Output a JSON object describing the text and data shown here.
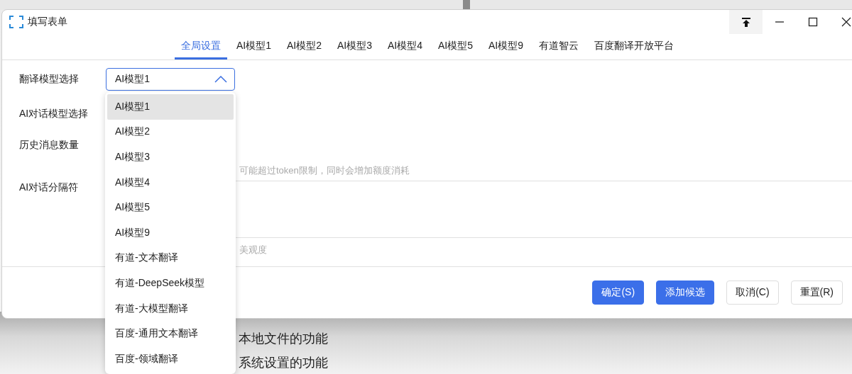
{
  "window": {
    "title": "填写表单"
  },
  "tabs": [
    {
      "label": "全局设置",
      "selected": true
    },
    {
      "label": "AI模型1",
      "selected": false
    },
    {
      "label": "AI模型2",
      "selected": false
    },
    {
      "label": "AI模型3",
      "selected": false
    },
    {
      "label": "AI模型4",
      "selected": false
    },
    {
      "label": "AI模型5",
      "selected": false
    },
    {
      "label": "AI模型9",
      "selected": false
    },
    {
      "label": "有道智云",
      "selected": false
    },
    {
      "label": "百度翻译开放平台",
      "selected": false
    }
  ],
  "form": {
    "fields": [
      {
        "label": "翻译模型选择",
        "kind": "select",
        "value": "AI模型1",
        "expanded": true
      },
      {
        "label": "AI对话模型选择",
        "kind": "plain"
      },
      {
        "label": "历史消息数量",
        "kind": "plain",
        "hint": "可能超过token限制，同时会增加额度消耗"
      },
      {
        "label": "AI对话分隔符",
        "kind": "tall",
        "hint": "美观度"
      }
    ]
  },
  "dropdown": {
    "options": [
      {
        "label": "AI模型1",
        "selected": true
      },
      {
        "label": "AI模型2",
        "selected": false
      },
      {
        "label": "AI模型3",
        "selected": false
      },
      {
        "label": "AI模型4",
        "selected": false
      },
      {
        "label": "AI模型5",
        "selected": false
      },
      {
        "label": "AI模型9",
        "selected": false
      },
      {
        "label": "有道-文本翻译",
        "selected": false
      },
      {
        "label": "有道-DeepSeek模型",
        "selected": false
      },
      {
        "label": "有道-大模型翻译",
        "selected": false
      },
      {
        "label": "百度-通用文本翻译",
        "selected": false
      },
      {
        "label": "百度-领域翻译",
        "selected": false
      }
    ]
  },
  "buttons": [
    {
      "label": "确定(S)",
      "kind": "primary"
    },
    {
      "label": "添加候选",
      "kind": "primary"
    },
    {
      "label": "取消(C)",
      "kind": "default"
    },
    {
      "label": "重置(R)",
      "kind": "default"
    }
  ],
  "background_texts": [
    "本地文件的功能",
    "系统设置的功能"
  ]
}
